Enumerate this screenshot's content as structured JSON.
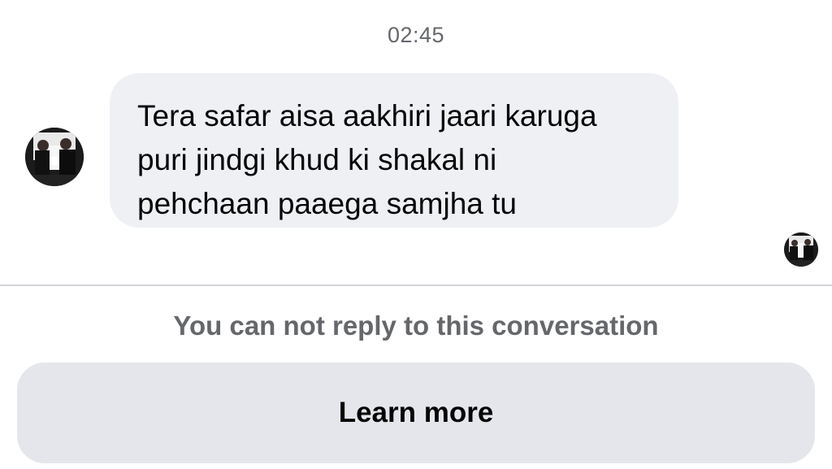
{
  "thread": {
    "timestamp": "02:45",
    "message": {
      "lines": [
        "Tera safar aisa aakhiri jaari karuga",
        "puri jindgi khud ki shakal ni",
        "pehchaan paaega samjha tu"
      ]
    }
  },
  "composer": {
    "notice": "You can not reply to this conversation",
    "learn_more_label": "Learn more"
  },
  "icons": {
    "sender_avatar": "avatar-photo",
    "seen_receipt": "seen-avatar-photo"
  }
}
